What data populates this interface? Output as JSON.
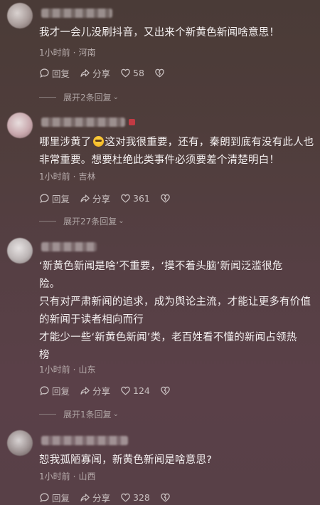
{
  "comments": [
    {
      "lines": [
        "我才一会儿没刷抖音，又出来个新黄色新闻啥意思！"
      ],
      "time": "1小时前",
      "location": "河南",
      "reply_label": "回复",
      "share_label": "分享",
      "likes": "58",
      "expand_label": "展开2条回复"
    },
    {
      "lines": [
        "哪里涉黄了",
        "这对我很重要，还有，秦朗到底有没有此人也",
        "非常重要。想要杜绝此类事件必须要差个清楚明白！"
      ],
      "time": "1小时前",
      "location": "吉林",
      "reply_label": "回复",
      "share_label": "分享",
      "likes": "361",
      "expand_label": "展开27条回复"
    },
    {
      "lines": [
        "‘新黄色新闻是啥’不重要，‘摸不着头脑’新闻泛滥很危",
        "险。",
        "只有对严肃新闻的追求，成为舆论主流，才能让更多有价值",
        "的新闻于读者相向而行",
        "才能少一些‘新黄色新闻’类，老百姓看不懂的新闻占领热",
        "榜"
      ],
      "time": "1小时前",
      "location": "山东",
      "reply_label": "回复",
      "share_label": "分享",
      "likes": "124",
      "expand_label": "展开1条回复"
    },
    {
      "lines": [
        "恕我孤陋寡闻，新黄色新闻是啥意思?"
      ],
      "time": "1小时前",
      "location": "山西",
      "reply_label": "回复",
      "share_label": "分享",
      "likes": "328"
    }
  ],
  "icons": {
    "reply": "reply-bubble-icon",
    "share": "share-arrow-icon",
    "like": "heart-icon",
    "dislike": "broken-heart-icon",
    "expand": "chevron-down-icon"
  },
  "colors": {
    "background_top": "#4a3b37",
    "background_bottom": "#584047",
    "text": "#f4f0f0",
    "meta": "#b7acac"
  }
}
